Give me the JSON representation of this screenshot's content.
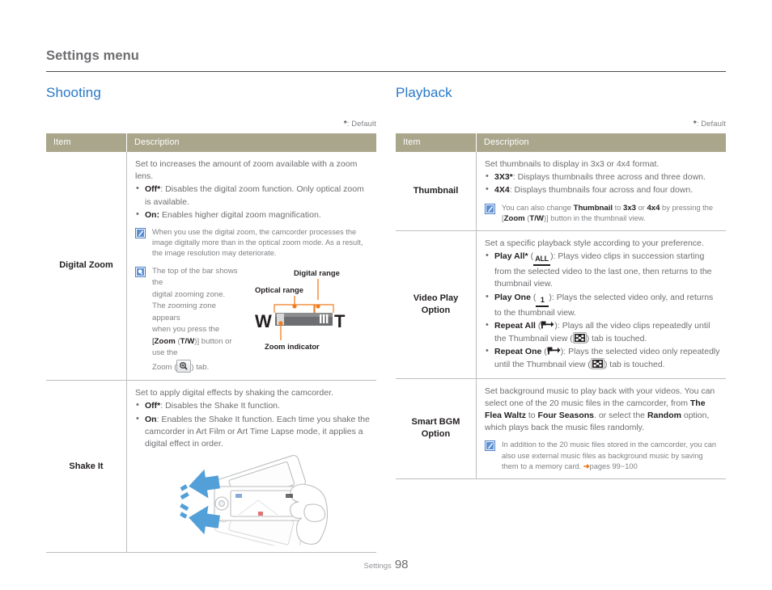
{
  "header": {
    "title": "Settings menu"
  },
  "footer": {
    "label": "Settings",
    "page_number": "98"
  },
  "colors": {
    "accent": "#2878c8",
    "table_header_bg": "#a9a68c",
    "orange": "#e8730c"
  },
  "left": {
    "section_title": "Shooting",
    "default_note": ": Default",
    "default_star": "*",
    "columns": {
      "item": "Item",
      "description": "Description"
    },
    "rows": [
      {
        "item": "Digital Zoom",
        "lead": "Set to increases the amount of zoom available with a zoom lens.",
        "bullets": [
          {
            "term": "Off*",
            "sep": ": ",
            "text": "Disables the digital zoom function. Only optical zoom is available."
          },
          {
            "term": "On:",
            "sep": " ",
            "text": "Enables higher digital zoom magnification."
          }
        ],
        "note": "When you use the digital zoom, the camcorder processes the image digitally more than in the optical zoom mode. As a result, the image resolution may deteriorate.",
        "tip_lines": [
          "The top of the bar shows the",
          "digital zooming zone.",
          "The zooming zone appears",
          "when you press the"
        ],
        "tip_zoom_prefix": "[",
        "tip_zoom_bold": "Zoom",
        "tip_zoom_mid": " (",
        "tip_zoom_tw": "T/W",
        "tip_zoom_suffix": ")] button or use the",
        "tip_tab_prefix": "Zoom (",
        "tip_tab_suffix": ") tab.",
        "figure_labels": {
          "digital_range": "Digital range",
          "optical_range": "Optical range",
          "zoom_indicator": "Zoom indicator",
          "wide": "W",
          "tele": "T"
        }
      },
      {
        "item": "Shake It",
        "lead": "Set to apply digital effects by shaking the camcorder.",
        "bullets": [
          {
            "term": "Off*",
            "sep": ": ",
            "text": "Disables the Shake It function."
          },
          {
            "term": "On",
            "sep": ": ",
            "text": "Enables the Shake It function. Each time you shake the camcorder in Art Film or Art Time Lapse mode, it applies a digital effect in order."
          }
        ]
      }
    ]
  },
  "right": {
    "section_title": "Playback",
    "default_note": ": Default",
    "default_star": "*",
    "columns": {
      "item": "Item",
      "description": "Description"
    },
    "rows": [
      {
        "item": "Thumbnail",
        "lead": "Set thumbnails to display in 3x3 or 4x4 format.",
        "bullets": [
          {
            "term": "3X3*",
            "sep": ": ",
            "text": "Displays thumbnails three across and three down."
          },
          {
            "term": "4X4",
            "sep": ": ",
            "text": "Displays thumbnails four across and four down."
          }
        ],
        "note_parts": {
          "p1": "You can also change ",
          "b1": "Thumbnail",
          "p2": " to ",
          "b2": "3x3",
          "p3": " or ",
          "b3": "4x4",
          "p4": " by pressing the [",
          "b4": "Zoom",
          "p5": " (",
          "b5": "T/W",
          "p6": ")] button in the thumbnail view."
        }
      },
      {
        "item": "Video Play Option",
        "lead": "Set a specific playback style according to your preference.",
        "bullets": [
          {
            "term": "Play All*",
            "icon": "ALL",
            "text": "Plays video clips in succession starting from the selected video to the last one, then returns to the thumbnail view."
          },
          {
            "term": "Play One",
            "icon": "1",
            "text": "Plays the selected video only, and returns to the thumbnail view."
          },
          {
            "term": "Repeat All",
            "icon": "repeat",
            "text": "Plays all the video clips repeatedly until the Thumbnail view (",
            "text2": ") tab is touched."
          },
          {
            "term": "Repeat One",
            "icon": "repeat",
            "text": "Plays the selected video only repeatedly until the Thumbnail view (",
            "text2": ") tab is touched."
          }
        ]
      },
      {
        "item": "Smart BGM Option",
        "lead_parts": {
          "p1": "Set background music to play back with your videos. You can select one of the 20 music files in the camcorder, from ",
          "b1": "The Flea Waltz",
          "p2": " to ",
          "b2": "Four Seasons",
          "p3": ". or select the ",
          "b3": "Random",
          "p4": " option, which plays back the music files randomly."
        },
        "note_parts": {
          "p1": "In addition to the 20 music files stored in the camcorder, you can also use external music files as background music by saving them to a memory card. ",
          "arrow": "➜",
          "p2": "pages 99~100"
        }
      }
    ]
  }
}
